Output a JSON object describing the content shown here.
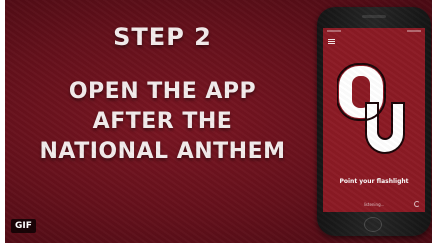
{
  "slide": {
    "step_label": "STEP 2",
    "instruction_lines": [
      "OPEN THE APP",
      "AFTER THE",
      "NATIONAL ANTHEM"
    ],
    "badge": "GIF"
  },
  "phone_screen": {
    "logo": "OU",
    "prompt": "Point your flashlight",
    "status": "listening..."
  },
  "colors": {
    "background": "#63101b",
    "screen": "#8b1a24",
    "text": "#f3ecec"
  }
}
